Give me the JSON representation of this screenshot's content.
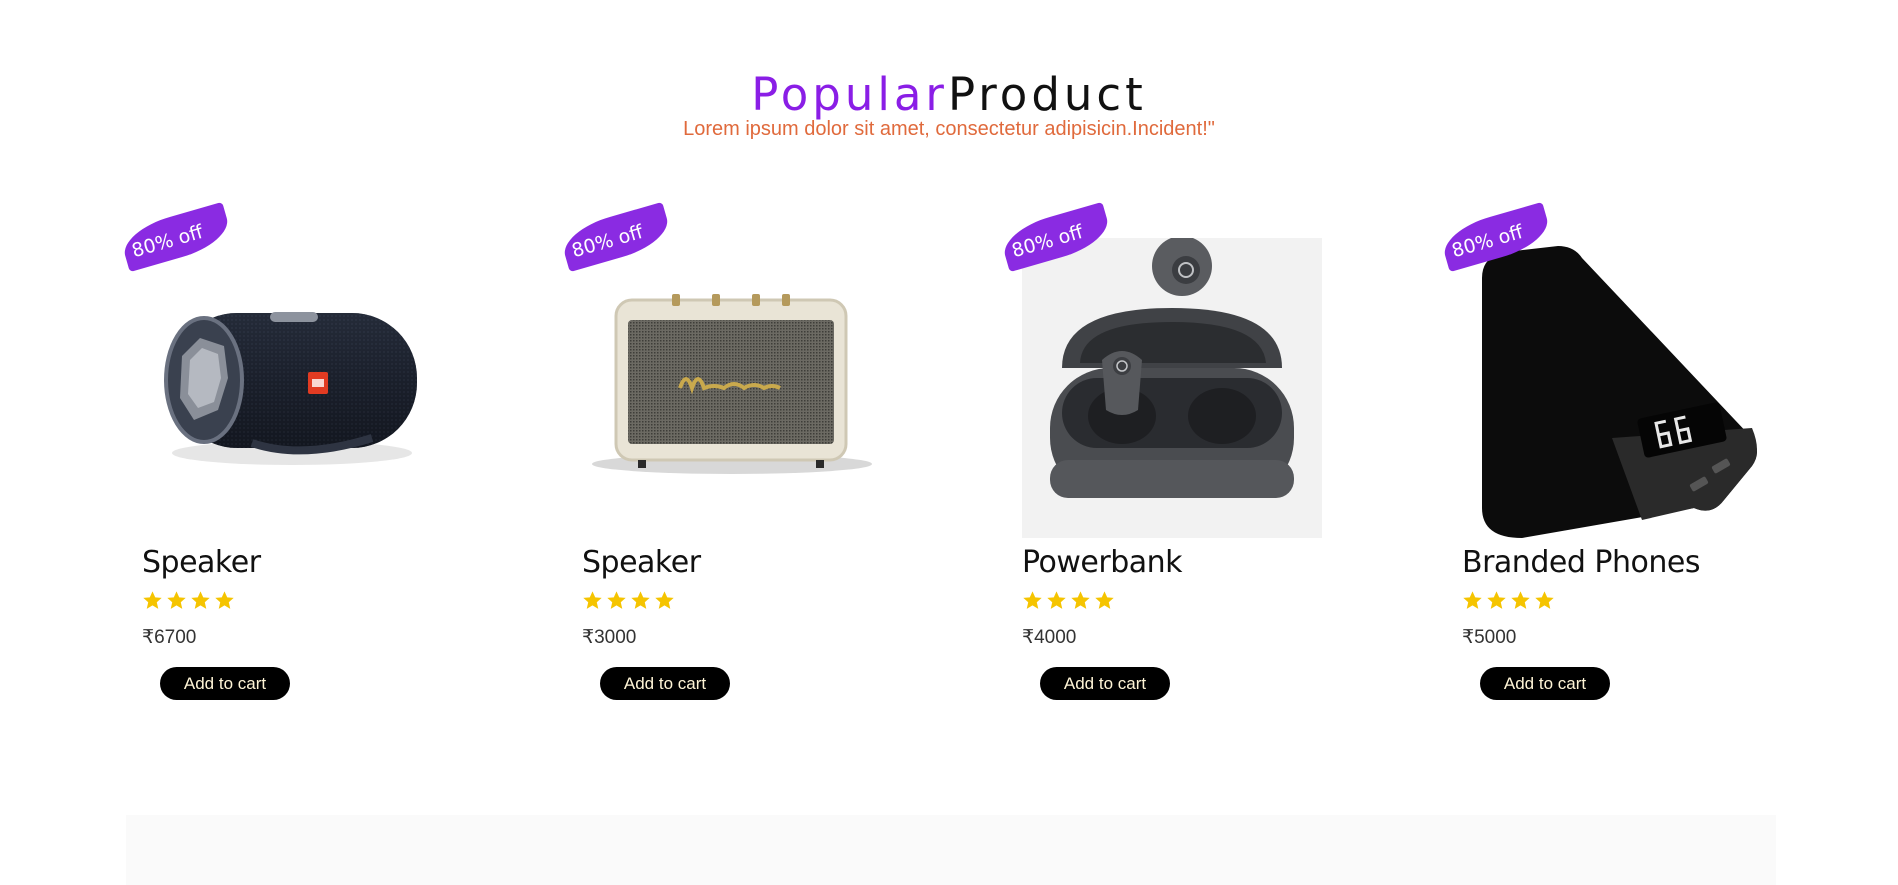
{
  "header": {
    "title_accent": "Popular",
    "title_main": "Product",
    "subtitle": "Lorem ipsum dolor sit amet, consectetur adipisicin.Incident!\""
  },
  "colors": {
    "accent": "#8a1ee6",
    "subtitle": "#e06a3c",
    "star": "#f5c400",
    "button_bg": "#000000"
  },
  "products": [
    {
      "badge": "80% off",
      "name": "Speaker",
      "rating": 4,
      "price": "₹6700",
      "button": "Add to cart",
      "image": "portable-speaker-image"
    },
    {
      "badge": "80% off",
      "name": "Speaker",
      "rating": 4,
      "price": "₹3000",
      "button": "Add to cart",
      "image": "marshall-speaker-image"
    },
    {
      "badge": "80% off",
      "name": "Powerbank",
      "rating": 4,
      "price": "₹4000",
      "button": "Add to cart",
      "image": "wireless-earbuds-image"
    },
    {
      "badge": "80% off",
      "name": "Branded Phones",
      "rating": 4,
      "price": "₹5000",
      "button": "Add to cart",
      "image": "powerbank-image"
    }
  ]
}
